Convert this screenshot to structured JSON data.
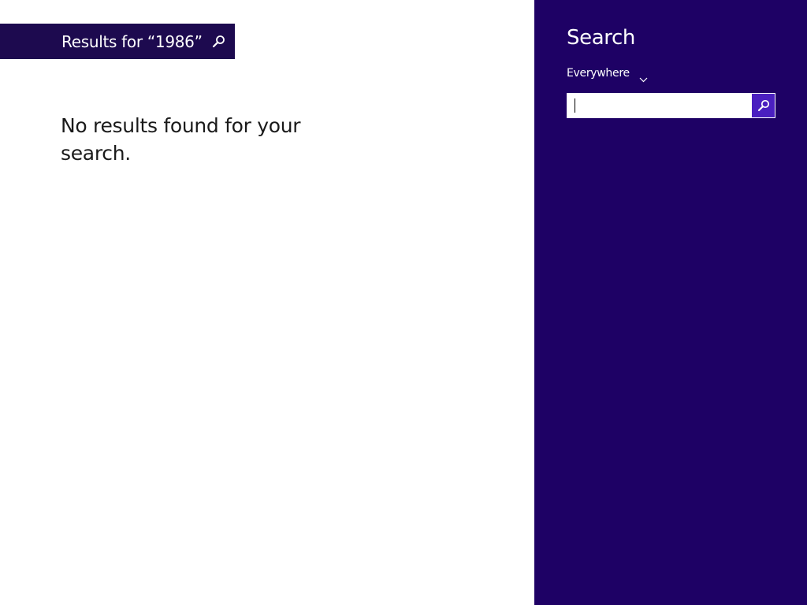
{
  "results": {
    "header_label": "Results for “1986”",
    "header_icon": "search-icon",
    "message": "No results found for your search."
  },
  "charm": {
    "title": "Search",
    "scope": {
      "selected": "Everywhere",
      "icon": "chevron-down-icon"
    },
    "search_box": {
      "value": "",
      "placeholder": "",
      "button_icon": "search-icon"
    }
  },
  "colors": {
    "header_bg": "#1d0a4f",
    "charm_bg": "#1e0165",
    "search_button_bg": "#4a1fc0",
    "text_dark": "#1a1a1a",
    "text_light": "#ffffff"
  }
}
